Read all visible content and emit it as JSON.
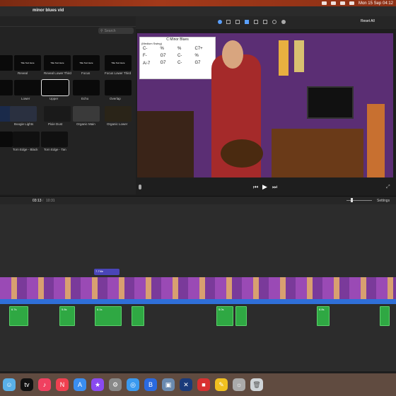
{
  "menubar": {
    "date_time": "Mon 15 Sep 04:12"
  },
  "window": {
    "title": "minor blues vid"
  },
  "browser": {
    "search_placeholder": "Search",
    "titles": [
      {
        "label": "",
        "tile_text": ""
      },
      {
        "label": "Reveal",
        "tile_text": "Title Text Here"
      },
      {
        "label": "Reveal Lower Third",
        "tile_text": "Title Text Here"
      },
      {
        "label": "Focus",
        "tile_text": "Title Text Here"
      },
      {
        "label": "Focus Lower Third",
        "tile_text": "Title Text Here"
      },
      {
        "label": "",
        "tile_text": ""
      },
      {
        "label": "Lower",
        "tile_text": ""
      },
      {
        "label": "Upper",
        "tile_text": ""
      },
      {
        "label": "Echo",
        "tile_text": ""
      },
      {
        "label": "Overlap",
        "tile_text": ""
      },
      {
        "label": "",
        "tile_text": ""
      },
      {
        "label": "Boogie Lights",
        "tile_text": ""
      },
      {
        "label": "Pixie Dust",
        "tile_text": ""
      },
      {
        "label": "Organic Main",
        "tile_text": ""
      },
      {
        "label": "Organic Lower",
        "tile_text": ""
      },
      {
        "label": "Torn Edge - Black",
        "tile_text": ""
      },
      {
        "label": "Torn Edge - Tan",
        "tile_text": ""
      }
    ]
  },
  "viewer": {
    "reset_label": "Reset All",
    "chart_title": "C Minor Blues",
    "chart_sub": "(Medium Swing)",
    "chords": [
      "C-",
      "%",
      "%",
      "C7+",
      "F-",
      "G7",
      "C-",
      "%",
      "A♭7",
      "G7",
      "C-",
      "G7"
    ]
  },
  "timeline": {
    "timecode": "03:13",
    "duration": "10:31",
    "settings_label": "Settings",
    "title_clip_label": "7-Title"
  },
  "dock": {
    "apps": [
      "finder",
      "appletv",
      "music",
      "news",
      "appstore",
      "imovie",
      "settings",
      "safari",
      "bluetooth",
      "preview",
      "xcode",
      "photobooth",
      "notes",
      "scripteditor",
      "trash"
    ]
  }
}
